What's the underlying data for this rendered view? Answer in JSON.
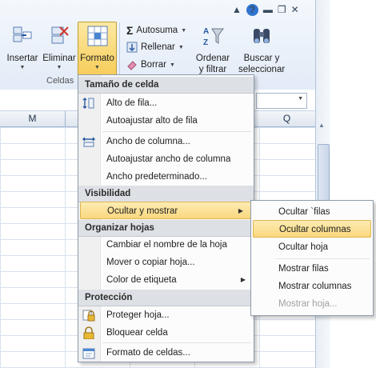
{
  "ribbon": {
    "cells_group_label": "Celdas",
    "insertar": "Insertar",
    "eliminar": "Eliminar",
    "formato": "Formato",
    "autosuma": "Autosuma",
    "rellenar": "Rellenar",
    "borrar": "Borrar",
    "ordenar_line1": "Ordenar",
    "ordenar_line2": "y filtrar",
    "buscar_line1": "Buscar y",
    "buscar_line2": "seleccionar",
    "help_glyph": "?"
  },
  "columns": [
    "M",
    "Q"
  ],
  "menu": {
    "sections": {
      "tamano": "Tamaño de celda",
      "visibilidad": "Visibilidad",
      "organizar": "Organizar hojas",
      "proteccion": "Protección"
    },
    "items": {
      "alto_fila": "Alto de fila...",
      "autoajustar_alto": "Autoajustar alto de fila",
      "ancho_columna": "Ancho de columna...",
      "autoajustar_ancho": "Autoajustar ancho de columna",
      "ancho_predeterminado": "Ancho predeterminado...",
      "ocultar_mostrar": "Ocultar y mostrar",
      "cambiar_nombre": "Cambiar el nombre de la hoja",
      "mover_copiar": "Mover o copiar hoja...",
      "color_etiqueta": "Color de etiqueta",
      "proteger_hoja": "Proteger hoja...",
      "bloquear_celda": "Bloquear celda",
      "formato_celdas": "Formato de celdas..."
    }
  },
  "submenu": {
    "ocultar_filas": "Ocultar `filas",
    "ocultar_columnas": "Ocultar columnas",
    "ocultar_hoja": "Ocultar hoja",
    "mostrar_filas": "Mostrar filas",
    "mostrar_columnas": "Mostrar columnas",
    "mostrar_hoja": "Mostrar hoja..."
  },
  "colors": {
    "highlight": "#f9d77e",
    "section_bg": "#dde1e6",
    "ribbon_bg": "#e2ebf7"
  }
}
